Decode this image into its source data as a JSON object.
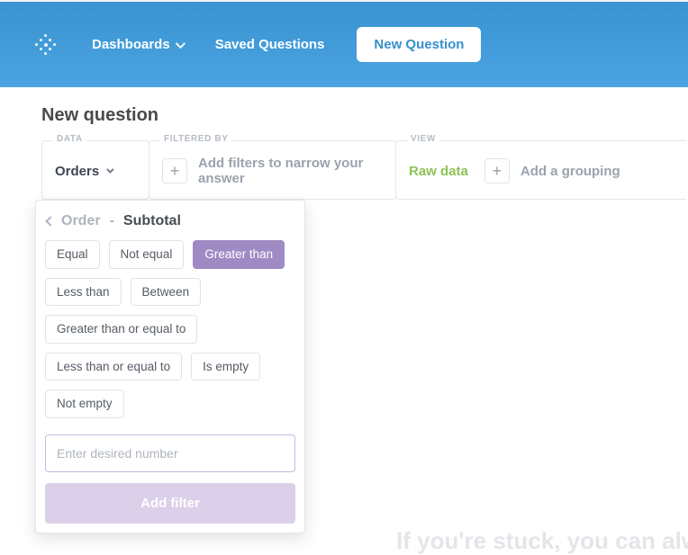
{
  "nav": {
    "dashboards": "Dashboards",
    "saved_questions": "Saved Questions",
    "new_question": "New Question"
  },
  "page": {
    "title": "New question"
  },
  "builder": {
    "data_label": "DATA",
    "filtered_by_label": "FILTERED BY",
    "view_label": "VIEW",
    "table": "Orders",
    "filter_hint": "Add filters to narrow your answer",
    "raw_data": "Raw data",
    "grouping_hint": "Add a grouping"
  },
  "popover": {
    "crumb_parent": "Order",
    "crumb_sep": "-",
    "crumb_current": "Subtotal",
    "operators": [
      {
        "label": "Equal",
        "selected": false
      },
      {
        "label": "Not equal",
        "selected": false
      },
      {
        "label": "Greater than",
        "selected": true
      },
      {
        "label": "Less than",
        "selected": false
      },
      {
        "label": "Between",
        "selected": false
      },
      {
        "label": "Greater than or equal to",
        "selected": false
      },
      {
        "label": "Less than or equal to",
        "selected": false
      },
      {
        "label": "Is empty",
        "selected": false
      },
      {
        "label": "Not empty",
        "selected": false
      }
    ],
    "input_placeholder": "Enter desired number",
    "input_value": "",
    "add_filter": "Add filter"
  },
  "footer": {
    "stuck": "If you're stuck, you can alw"
  },
  "colors": {
    "header_blue": "#3d97d3",
    "accent_purple": "#a08ac4",
    "raw_green": "#8ec355"
  }
}
